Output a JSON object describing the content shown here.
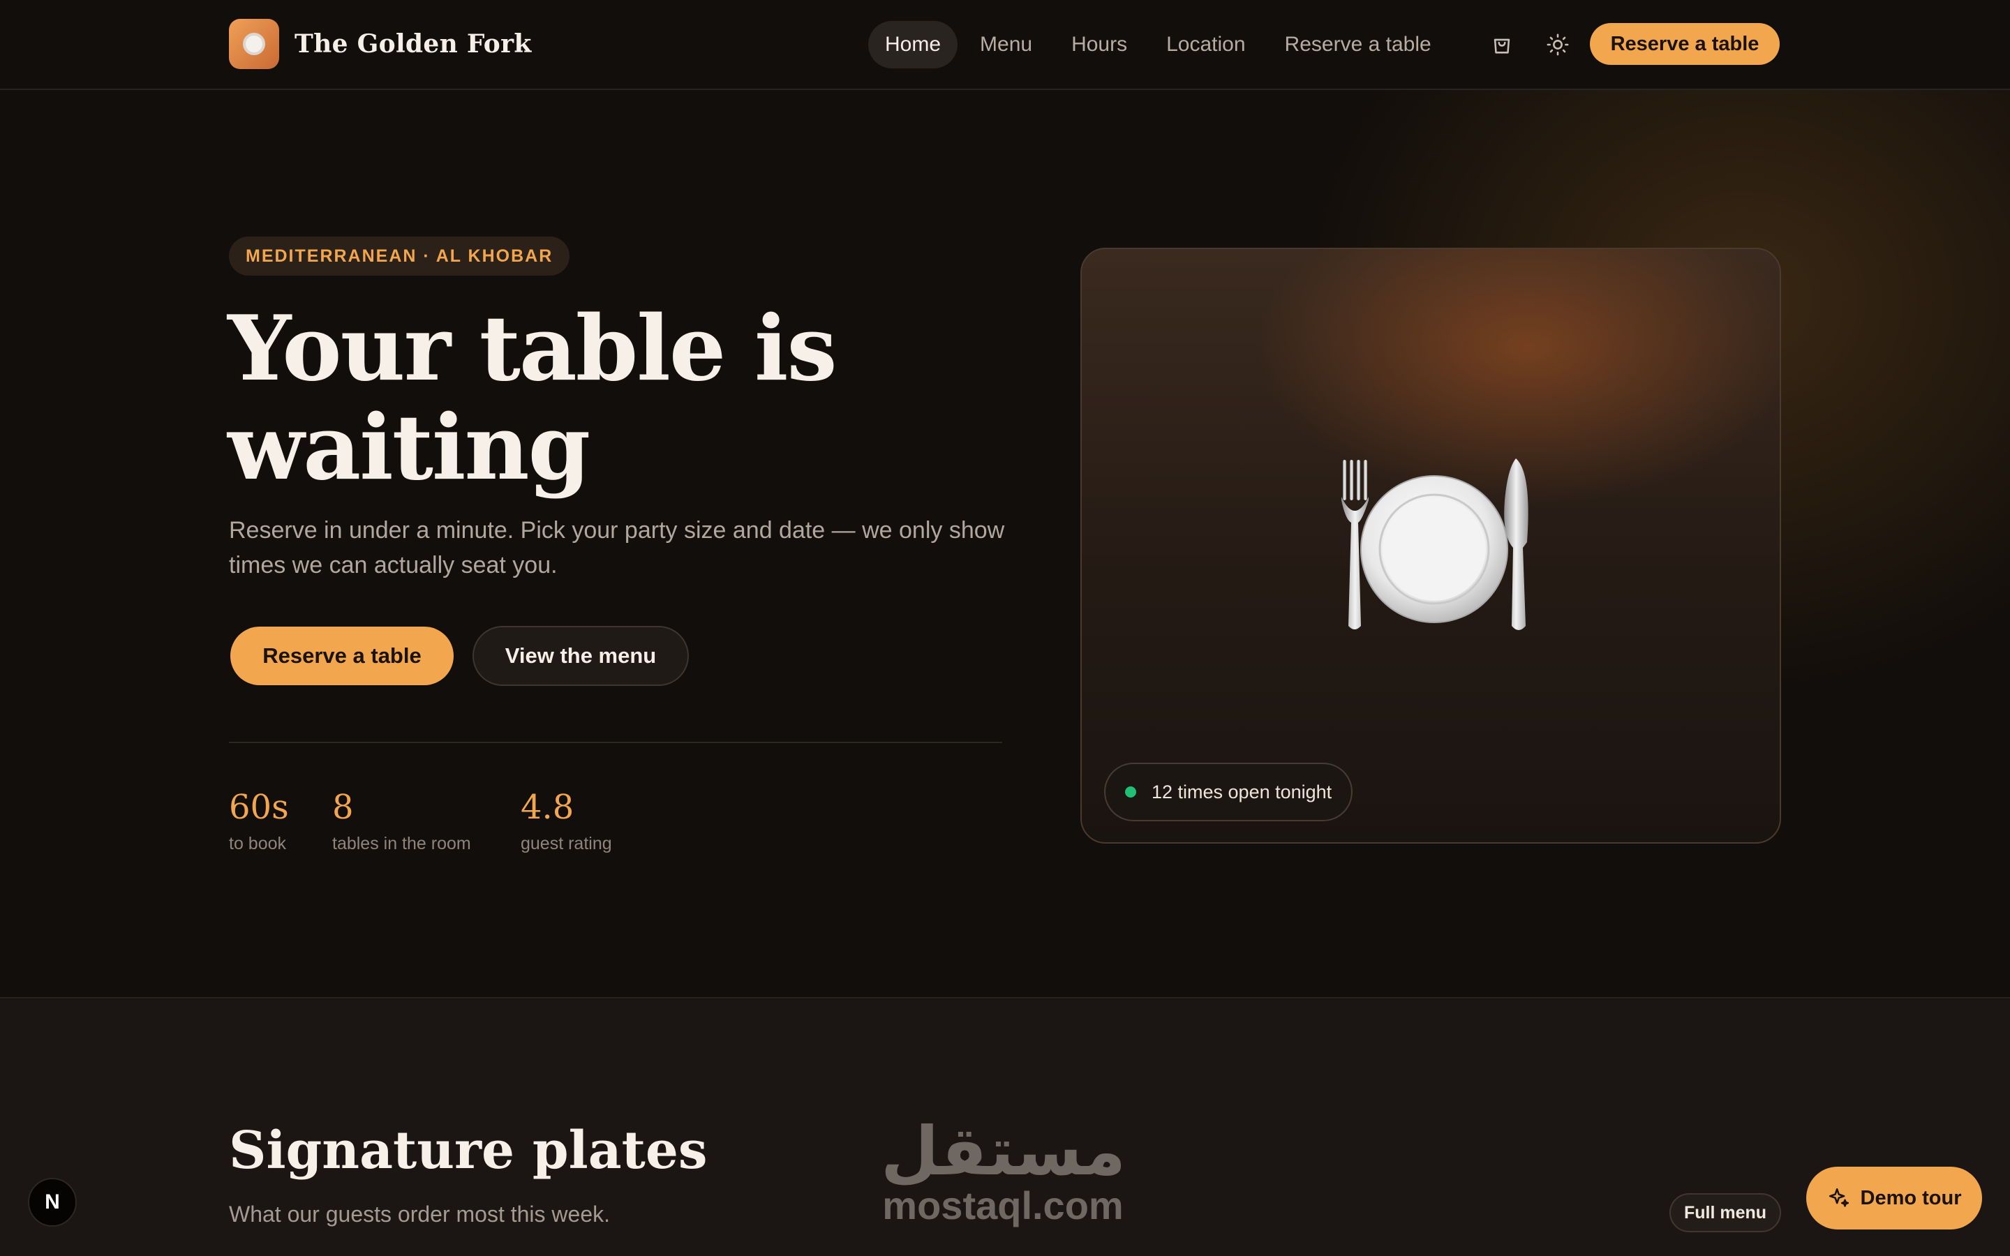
{
  "nav": {
    "brand_name": "The Golden Fork",
    "links": [
      {
        "label": "Home",
        "active": true
      },
      {
        "label": "Menu",
        "active": false
      },
      {
        "label": "Hours",
        "active": false
      },
      {
        "label": "Location",
        "active": false
      },
      {
        "label": "Reserve a table",
        "active": false
      }
    ],
    "cart_icon": "shopping-bag-icon",
    "theme_icon": "sun-icon",
    "cta_label": "Reserve a table"
  },
  "hero": {
    "eyebrow": "MEDITERRANEAN · AL KHOBAR",
    "headline_line1": "Your table is",
    "headline_line2": "waiting",
    "subcopy": "Reserve in under a minute. Pick your party size and date — we only show times we can actually seat you.",
    "primary_cta": "Reserve a table",
    "secondary_cta": "View the menu",
    "stats": [
      {
        "value": "60s",
        "label": "to book"
      },
      {
        "value": "8",
        "label": "tables in the room"
      },
      {
        "value": "4.8",
        "label": "guest rating"
      }
    ],
    "card": {
      "illustration_icon": "fork-plate-knife-icon",
      "status_text": "12 times open tonight",
      "status_color": "#1fbf75"
    }
  },
  "signature": {
    "title": "Signature plates",
    "subtitle": "What our guests order most this week.",
    "full_menu_label": "Full menu"
  },
  "watermark": {
    "arabic": "مستقل",
    "latin": "mostaql.com"
  },
  "floating": {
    "demo_tour_label": "Demo tour",
    "demo_tour_icon": "sparkles-icon",
    "framework_badge": "N"
  },
  "colors": {
    "accent": "#f2a64d",
    "background": "#120e0b",
    "status_green": "#1fbf75"
  }
}
